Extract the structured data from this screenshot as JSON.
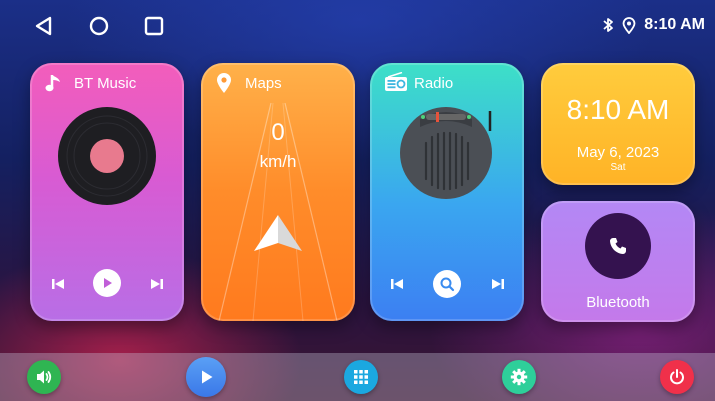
{
  "status": {
    "time": "8:10 AM",
    "icons": [
      "bluetooth-icon",
      "location-icon"
    ],
    "nav": [
      "back-icon",
      "home-icon",
      "recents-icon"
    ]
  },
  "cards": {
    "music": {
      "title": "BT Music",
      "controls": [
        "previous-icon",
        "play-icon",
        "next-icon"
      ]
    },
    "maps": {
      "title": "Maps",
      "speed": "0",
      "unit": "km/h"
    },
    "radio": {
      "title": "Radio",
      "controls": [
        "previous-icon",
        "search-icon",
        "next-icon"
      ]
    },
    "clock": {
      "time": "8:10 AM",
      "date": "May 6, 2023",
      "day": "Sat"
    },
    "bluetooth": {
      "label": "Bluetooth"
    }
  },
  "dock": [
    {
      "name": "volume-icon",
      "color": "#2fb552"
    },
    {
      "name": "play-icon",
      "color": "#3a86f0"
    },
    {
      "name": "apps-grid-icon",
      "color": "#1ba8e0"
    },
    {
      "name": "settings-icon",
      "color": "#2ecf9a"
    },
    {
      "name": "power-icon",
      "color": "#f0304a"
    }
  ]
}
